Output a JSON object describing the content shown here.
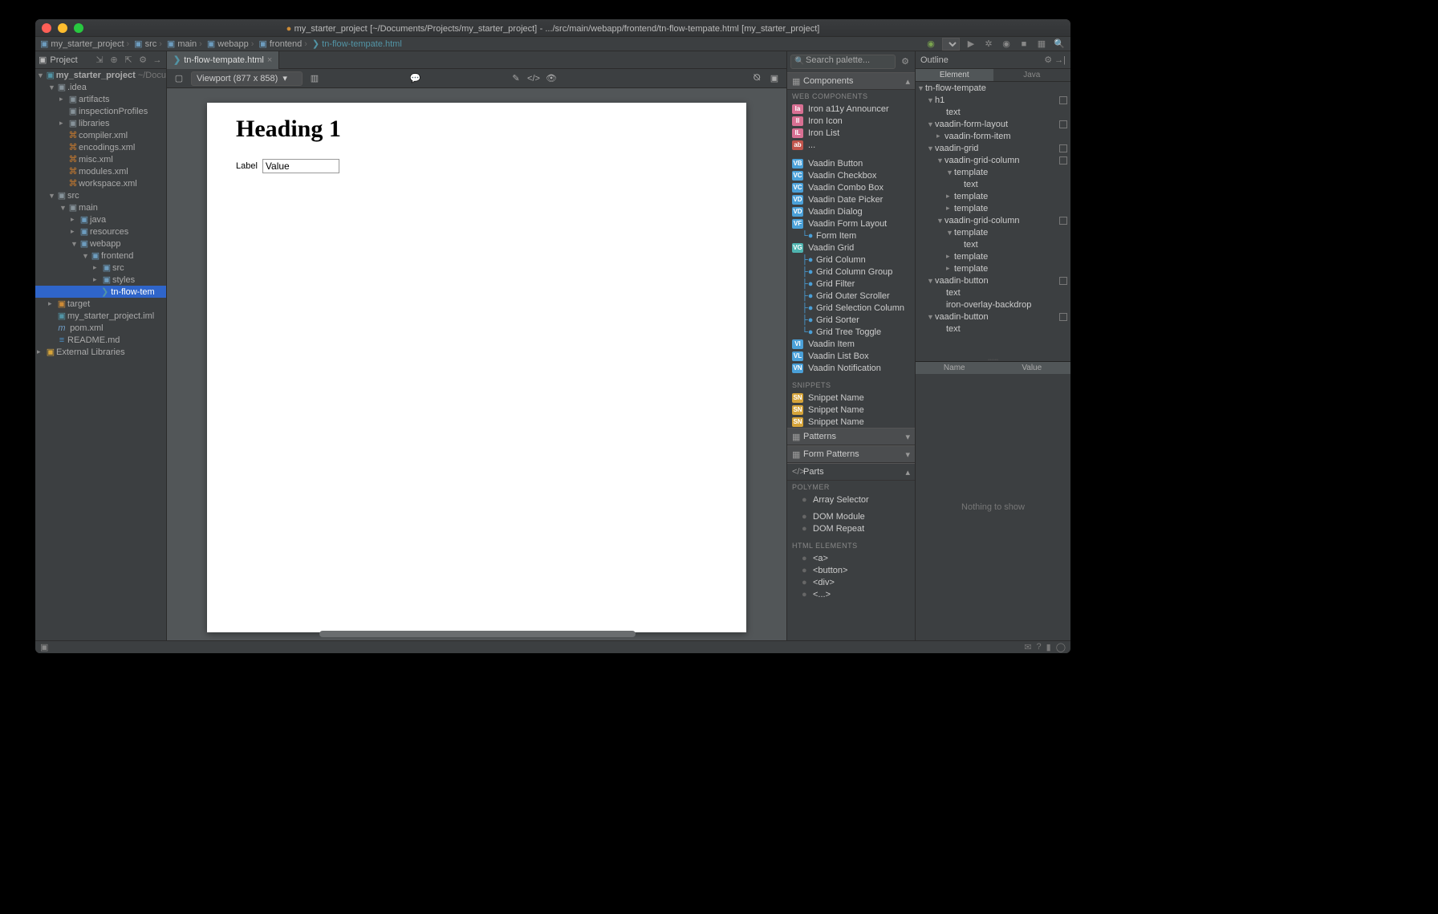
{
  "title": {
    "project": "my_starter_project",
    "path_hint": "[~/Documents/Projects/my_starter_project]",
    "file_hint": "- .../src/main/webapp/frontend/tn-flow-tempate.html",
    "suffix": "[my_starter_project]"
  },
  "nav": {
    "crumbs": [
      "my_starter_project",
      "src",
      "main",
      "webapp",
      "frontend"
    ],
    "file": "tn-flow-tempate.html"
  },
  "sidebar": {
    "label": "Project",
    "tree": {
      "root": "my_starter_project",
      "root_hint": "~/Docu",
      "idea": ".idea",
      "artifacts": "artifacts",
      "inspectionProfiles": "inspectionProfiles",
      "libraries": "libraries",
      "compiler": "compiler.xml",
      "encodings": "encodings.xml",
      "misc": "misc.xml",
      "modules": "modules.xml",
      "workspace": "workspace.xml",
      "src": "src",
      "main": "main",
      "java": "java",
      "resources": "resources",
      "webapp": "webapp",
      "frontend": "frontend",
      "src2": "src",
      "styles": "styles",
      "tn_flow": "tn-flow-tem",
      "target": "target",
      "iml": "my_starter_project.iml",
      "pom": "pom.xml",
      "readme": "README.md",
      "ext": "External Libraries"
    }
  },
  "tabs": {
    "active": "tn-flow-tempate.html"
  },
  "viewport": {
    "label": "Viewport (877 x 858)"
  },
  "preview": {
    "heading": "Heading 1",
    "label": "Label",
    "value": "Value"
  },
  "palette": {
    "search_placeholder": "Search palette...",
    "sections": {
      "components": "Components",
      "web_components": "WEB COMPONENTS",
      "iron_a11y": "Iron a11y Announcer",
      "iron_icon": "Iron Icon",
      "iron_list": "Iron List",
      "ellipsis": "...",
      "vaadin_button": "Vaadin Button",
      "vaadin_checkbox": "Vaadin Checkbox",
      "vaadin_combo": "Vaadin Combo Box",
      "vaadin_date": "Vaadin Date Picker",
      "vaadin_dialog": "Vaadin Dialog",
      "vaadin_form": "Vaadin Form Layout",
      "form_item": "Form Item",
      "vaadin_grid": "Vaadin Grid",
      "grid_column": "Grid Column",
      "grid_column_group": "Grid Column Group",
      "grid_filter": "Grid Filter",
      "grid_outer": "Grid Outer Scroller",
      "grid_sel": "Grid Selection Column",
      "grid_sorter": "Grid Sorter",
      "grid_tree": "Grid Tree Toggle",
      "vaadin_item": "Vaadin Item",
      "vaadin_list": "Vaadin List Box",
      "vaadin_notif": "Vaadin Notification",
      "snippets": "SNIPPETS",
      "snippet": "Snippet Name",
      "patterns": "Patterns",
      "form_patterns": "Form Patterns",
      "parts": "Parts",
      "polymer": "POLYMER",
      "array_sel": "Array Selector",
      "dom_module": "DOM Module",
      "dom_repeat": "DOM Repeat",
      "html_el": "HTML ELEMENTS",
      "a": "<a>",
      "button": "<button>",
      "div": "<div>",
      "more": "<...>"
    }
  },
  "outline": {
    "label": "Outline",
    "tab_element": "Element",
    "tab_java": "Java",
    "nodes": {
      "root": "tn-flow-tempate",
      "h1": "h1",
      "text": "text",
      "form_layout": "vaadin-form-layout",
      "form_item": "vaadin-form-item",
      "grid": "vaadin-grid",
      "grid_col": "vaadin-grid-column",
      "template": "template",
      "button": "vaadin-button",
      "backdrop": "iron-overlay-backdrop"
    },
    "props_name": "Name",
    "props_value": "Value",
    "nothing": "Nothing to show"
  }
}
